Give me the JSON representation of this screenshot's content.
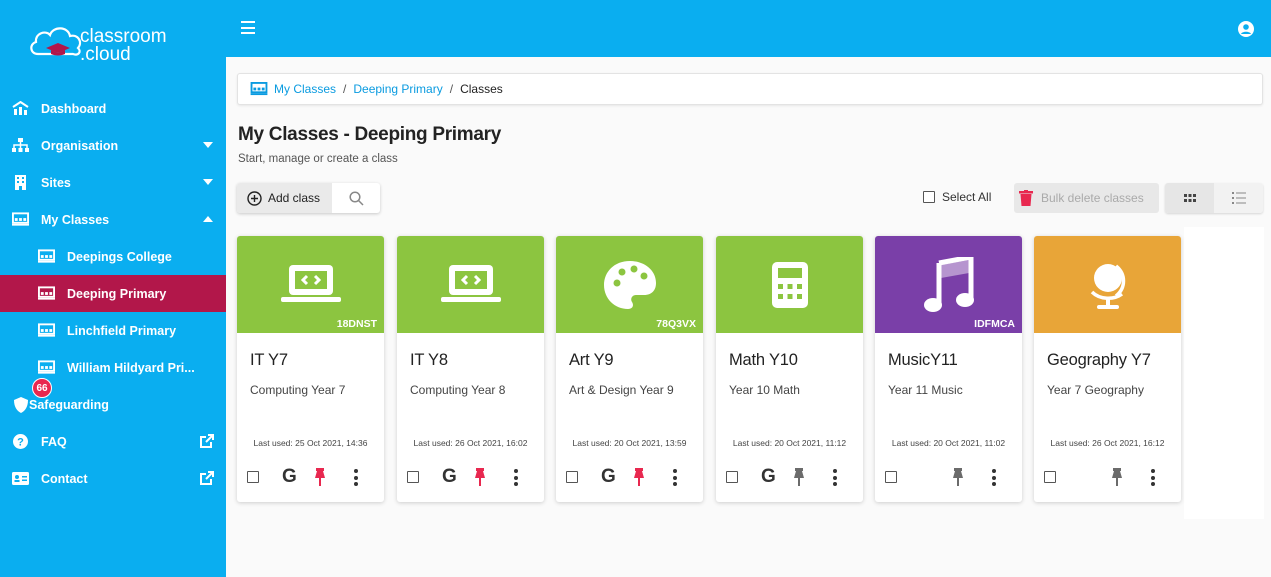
{
  "app": {
    "logo_line1": "classroom",
    "logo_line2": ".cloud"
  },
  "sidebar": {
    "items": [
      {
        "label": "Dashboard"
      },
      {
        "label": "Organisation"
      },
      {
        "label": "Sites"
      },
      {
        "label": "My Classes"
      },
      {
        "label": "Deepings College"
      },
      {
        "label": "Deeping Primary"
      },
      {
        "label": "Linchfield Primary"
      },
      {
        "label": "William Hildyard Pri..."
      },
      {
        "label": "Safeguarding",
        "badge": "66"
      },
      {
        "label": "FAQ"
      },
      {
        "label": "Contact"
      }
    ]
  },
  "breadcrumb": {
    "items": [
      "My Classes",
      "Deeping Primary",
      "Classes"
    ],
    "separator": "/"
  },
  "page": {
    "title": "My Classes - Deeping Primary",
    "subtitle": "Start, manage or create a class"
  },
  "toolbar": {
    "add_label": "Add class",
    "select_all_label": "Select All",
    "bulk_delete_label": "Bulk delete classes"
  },
  "colors": {
    "sidebar": "#0aaef0",
    "active": "#b2174a",
    "green": "#8cc540",
    "purple": "#7a3fa8",
    "orange": "#e8a538",
    "pin_red": "#e8284f",
    "pin_grey": "#6b6b6b"
  },
  "cards": [
    {
      "title": "IT Y7",
      "desc": "Computing Year 7",
      "code": "18DNST",
      "used": "Last used: 25 Oct 2021, 14:36",
      "icon": "laptop-code-icon",
      "google": "G",
      "pinned": true
    },
    {
      "title": "IT Y8",
      "desc": "Computing Year 8",
      "code": "",
      "used": "Last used: 26 Oct 2021, 16:02",
      "icon": "laptop-code-icon",
      "google": "G",
      "pinned": true
    },
    {
      "title": "Art Y9",
      "desc": "Art & Design Year 9",
      "code": "78Q3VX",
      "used": "Last used: 20 Oct 2021, 13:59",
      "icon": "palette-icon",
      "google": "G",
      "pinned": true
    },
    {
      "title": "Math Y10",
      "desc": "Year 10 Math",
      "code": "",
      "used": "Last used: 20 Oct 2021, 11:12",
      "icon": "calculator-icon",
      "google": "G",
      "pinned": false
    },
    {
      "title": "MusicY11",
      "desc": "Year 11 Music",
      "code": "IDFMCA",
      "used": "Last used: 20 Oct 2021, 11:02",
      "icon": "music-note-icon",
      "google": "",
      "pinned": false
    },
    {
      "title": "Geography Y7",
      "desc": "Year 7 Geography",
      "code": "",
      "used": "Last used: 26 Oct 2021, 16:12",
      "icon": "globe-icon",
      "google": "",
      "pinned": false
    }
  ]
}
